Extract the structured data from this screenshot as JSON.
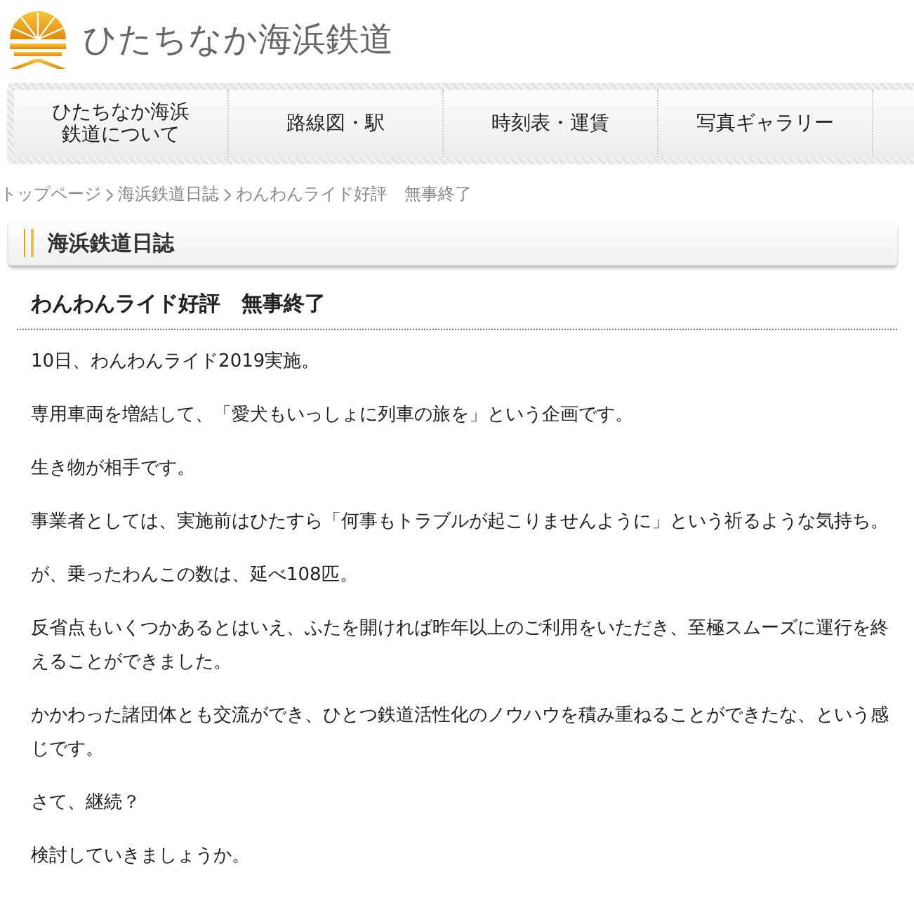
{
  "site": {
    "title": "ひたちなか海浜鉄道"
  },
  "nav": [
    {
      "label": "ひたちなか海浜鉄道について"
    },
    {
      "label": "路線図・駅"
    },
    {
      "label": "時刻表・運賃"
    },
    {
      "label": "写真ギャラリー"
    }
  ],
  "breadcrumb": [
    "トップページ",
    "海浜鉄道日誌",
    "わんわんライド好評　無事終了"
  ],
  "section": {
    "heading": "海浜鉄道日誌"
  },
  "article": {
    "title": "わんわんライド好評　無事終了",
    "paragraphs": [
      "10日、わんわんライド2019実施。",
      "専用車両を増結して、「愛犬もいっしょに列車の旅を」という企画です。",
      "生き物が相手です。",
      "事業者としては、実施前はひたすら「何事もトラブルが起こりませんように」という祈るような気持ち。",
      "が、乗ったわんこの数は、延べ108匹。",
      "反省点もいくつかあるとはいえ、ふたを開ければ昨年以上のご利用をいただき、至極スムーズに運行を終えることができました。",
      "かかわった諸団体とも交流ができ、ひとつ鉄道活性化のノウハウを積み重ねることができたな、という感じです。",
      "さて、継続？",
      "検討していきましょうか。"
    ]
  }
}
